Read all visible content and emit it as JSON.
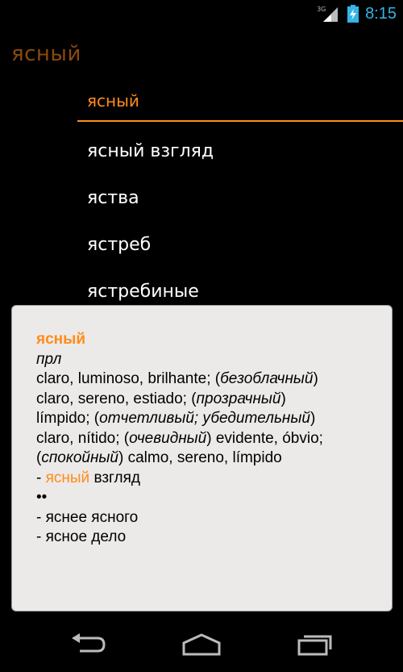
{
  "status_bar": {
    "network": "3G",
    "time": "8:15"
  },
  "header": {
    "search_term": "ясный"
  },
  "word_list": {
    "items": [
      {
        "label": "ясный",
        "selected": true
      },
      {
        "label": "ясный взгляд",
        "selected": false
      },
      {
        "label": "яства",
        "selected": false
      },
      {
        "label": "ястреб",
        "selected": false
      },
      {
        "label": "ястребиные",
        "selected": false
      }
    ]
  },
  "entry": {
    "headword": "ясный",
    "part_of_speech": "прл",
    "l1_a": "claro, luminoso, brilhante; (",
    "l1_b": "безоблачный",
    "l1_c": ")",
    "l2_a": "claro, sereno, estiado; (",
    "l2_b": "прозрачный",
    "l2_c": ")",
    "l3_a": "límpido; (",
    "l3_b": "отчетливый; убедительный",
    "l3_c": ")",
    "l4_a": "claro, nítido; (",
    "l4_b": "очевидный",
    "l4_c": ") evidente, óbvio;",
    "l5_a": "(",
    "l5_b": "спокойный",
    "l5_c": ") calmo, sereno, límpido",
    "ex1_a": "- ",
    "ex1_b": "ясный",
    "ex1_c": " взгляд",
    "marker": "••",
    "ex2": "- яснее ясного",
    "ex3": "- ясное дело"
  },
  "colors": {
    "accent": "#ff8c1a",
    "header_term": "#8a4a0a",
    "clock": "#33b5e5",
    "popup_bg": "#ece9e9"
  },
  "icons": {
    "signal": "signal-icon",
    "battery": "battery-charging-icon",
    "back": "back-icon",
    "home": "home-icon",
    "recents": "recent-apps-icon"
  }
}
